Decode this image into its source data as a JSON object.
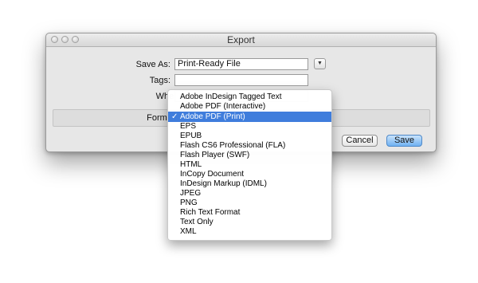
{
  "window": {
    "title": "Export"
  },
  "form": {
    "save_as_label": "Save As:",
    "save_as_value": "Print-Ready File",
    "tags_label": "Tags:",
    "tags_value": "",
    "where_label": "Where",
    "format_label": "Format"
  },
  "buttons": {
    "cancel": "Cancel",
    "save": "Save"
  },
  "format_menu": {
    "selected_index": 2,
    "check_glyph": "✓",
    "items": [
      "Adobe InDesign Tagged Text",
      "Adobe PDF (Interactive)",
      "Adobe PDF (Print)",
      "EPS",
      "EPUB",
      "Flash CS6 Professional (FLA)",
      "Flash Player (SWF)",
      "HTML",
      "InCopy Document",
      "InDesign Markup (IDML)",
      "JPEG",
      "PNG",
      "Rich Text Format",
      "Text Only",
      "XML"
    ]
  },
  "colors": {
    "selection": "#3f7ddc",
    "primary_button": "#6fb1f2"
  }
}
